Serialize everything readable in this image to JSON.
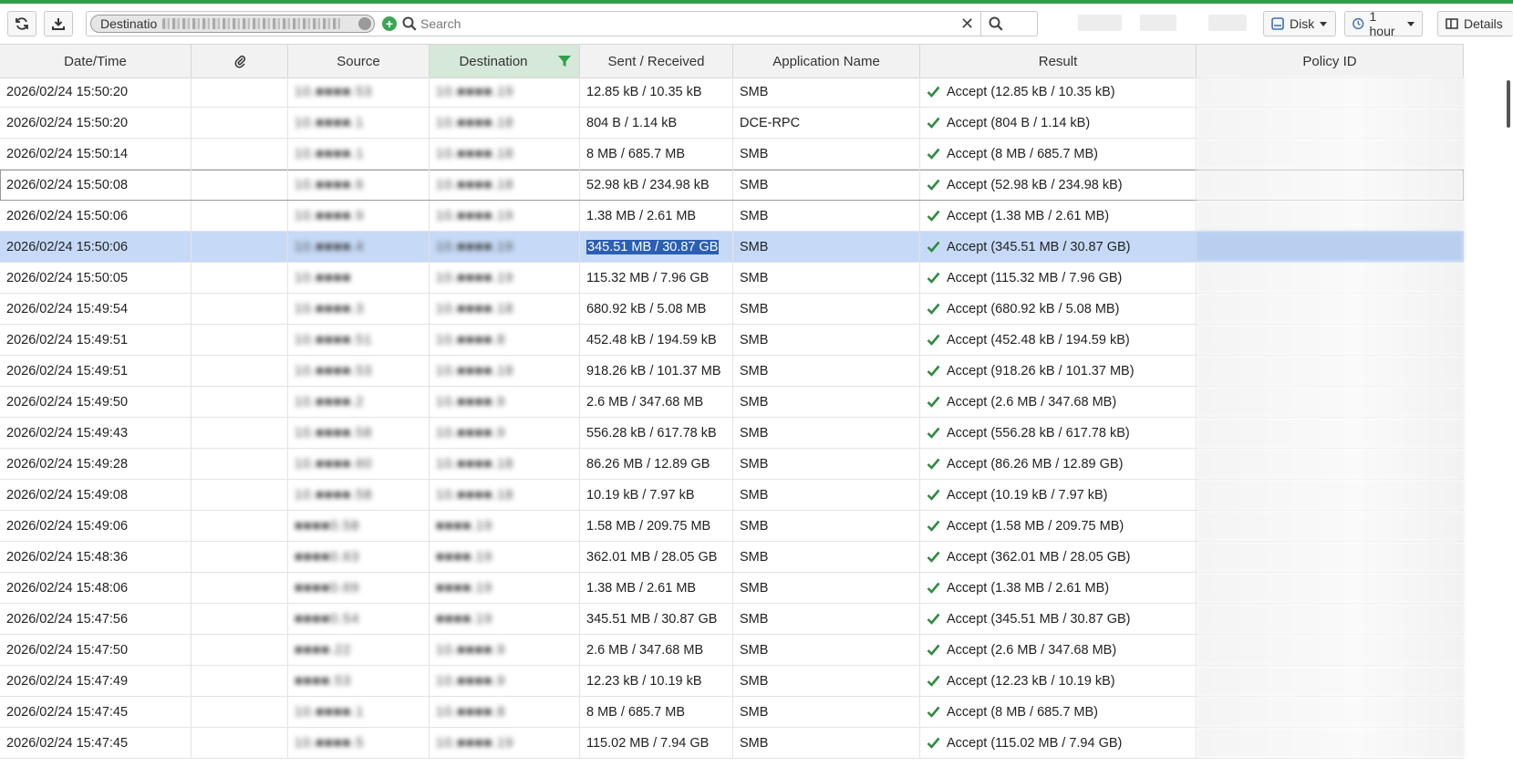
{
  "toolbar": {
    "refresh_icon": "refresh-icon",
    "download_icon": "download-icon",
    "filter_chip_label": "Destinatio",
    "search_placeholder": "Search",
    "clear_glyph": "✕",
    "storage_label": "Disk",
    "time_range_label": "1 hour",
    "details_label": "Details"
  },
  "columns": {
    "datetime": "Date/Time",
    "attachment_icon": "paperclip-icon",
    "source": "Source",
    "destination": "Destination",
    "sent_received": "Sent / Received",
    "app_name": "Application Name",
    "result": "Result",
    "policy_id": "Policy ID"
  },
  "rows": [
    {
      "datetime": "2026/02/24 15:50:20",
      "source": "10.■■■■.53",
      "destination": "10.■■■■.19",
      "sent_received": "12.85 kB / 10.35 kB",
      "app": "SMB",
      "result": "Accept (12.85 kB / 10.35 kB)"
    },
    {
      "datetime": "2026/02/24 15:50:20",
      "source": "10.■■■■.1",
      "destination": "10.■■■■.18",
      "sent_received": "804 B / 1.14 kB",
      "app": "DCE-RPC",
      "result": "Accept (804 B / 1.14 kB)"
    },
    {
      "datetime": "2026/02/24 15:50:14",
      "source": "10.■■■■.1",
      "destination": "10.■■■■.18",
      "sent_received": "8 MB / 685.7 MB",
      "app": "SMB",
      "result": "Accept (8 MB / 685.7 MB)"
    },
    {
      "datetime": "2026/02/24 15:50:08",
      "source": "10.■■■■.6",
      "destination": "10.■■■■.18",
      "sent_received": "52.98 kB / 234.98 kB",
      "app": "SMB",
      "result": "Accept (52.98 kB / 234.98 kB)"
    },
    {
      "datetime": "2026/02/24 15:50:06",
      "source": "10.■■■■.9",
      "destination": "10.■■■■.19",
      "sent_received": "1.38 MB / 2.61 MB",
      "app": "SMB",
      "result": "Accept (1.38 MB / 2.61 MB)"
    },
    {
      "datetime": "2026/02/24 15:50:06",
      "source": "10.■■■■.4",
      "destination": "10.■■■■.19",
      "sent_received": "345.51 MB / 30.87 GB",
      "app": "SMB",
      "result": "Accept (345.51 MB / 30.87 GB)"
    },
    {
      "datetime": "2026/02/24 15:50:05",
      "source": "10.■■■■",
      "destination": "10.■■■■.19",
      "sent_received": "115.32 MB / 7.96 GB",
      "app": "SMB",
      "result": "Accept (115.32 MB / 7.96 GB)"
    },
    {
      "datetime": "2026/02/24 15:49:54",
      "source": "10.■■■■.3",
      "destination": "10.■■■■.18",
      "sent_received": "680.92 kB / 5.08 MB",
      "app": "SMB",
      "result": "Accept (680.92 kB / 5.08 MB)"
    },
    {
      "datetime": "2026/02/24 15:49:51",
      "source": "10.■■■■.51",
      "destination": "10.■■■■.8",
      "sent_received": "452.48 kB / 194.59 kB",
      "app": "SMB",
      "result": "Accept (452.48 kB / 194.59 kB)"
    },
    {
      "datetime": "2026/02/24 15:49:51",
      "source": "10.■■■■.53",
      "destination": "10.■■■■.18",
      "sent_received": "918.26 kB / 101.37 MB",
      "app": "SMB",
      "result": "Accept (918.26 kB / 101.37 MB)"
    },
    {
      "datetime": "2026/02/24 15:49:50",
      "source": "10.■■■■.2",
      "destination": "10.■■■■.9",
      "sent_received": "2.6 MB / 347.68 MB",
      "app": "SMB",
      "result": "Accept (2.6 MB / 347.68 MB)"
    },
    {
      "datetime": "2026/02/24 15:49:43",
      "source": "10.■■■■.58",
      "destination": "10.■■■■.9",
      "sent_received": "556.28 kB / 617.78 kB",
      "app": "SMB",
      "result": "Accept (556.28 kB / 617.78 kB)"
    },
    {
      "datetime": "2026/02/24 15:49:28",
      "source": "10.■■■■.60",
      "destination": "10.■■■■.18",
      "sent_received": "86.26 MB / 12.89 GB",
      "app": "SMB",
      "result": "Accept (86.26 MB / 12.89 GB)"
    },
    {
      "datetime": "2026/02/24 15:49:08",
      "source": "10.■■■■.58",
      "destination": "10.■■■■.18",
      "sent_received": "10.19 kB / 7.97 kB",
      "app": "SMB",
      "result": "Accept (10.19 kB / 7.97 kB)"
    },
    {
      "datetime": "2026/02/24 15:49:06",
      "source": "■■■■0.58",
      "destination": "■■■■.19",
      "sent_received": "1.58 MB / 209.75 MB",
      "app": "SMB",
      "result": "Accept (1.58 MB / 209.75 MB)"
    },
    {
      "datetime": "2026/02/24 15:48:36",
      "source": "■■■■0.63",
      "destination": "■■■■.19",
      "sent_received": "362.01 MB / 28.05 GB",
      "app": "SMB",
      "result": "Accept (362.01 MB / 28.05 GB)"
    },
    {
      "datetime": "2026/02/24 15:48:06",
      "source": "■■■■0.69",
      "destination": "■■■■.19",
      "sent_received": "1.38 MB / 2.61 MB",
      "app": "SMB",
      "result": "Accept (1.38 MB / 2.61 MB)"
    },
    {
      "datetime": "2026/02/24 15:47:56",
      "source": "■■■■0.54",
      "destination": "■■■■.19",
      "sent_received": "345.51 MB / 30.87 GB",
      "app": "SMB",
      "result": "Accept (345.51 MB / 30.87 GB)"
    },
    {
      "datetime": "2026/02/24 15:47:50",
      "source": "■■■■.22",
      "destination": "10.■■■■.9",
      "sent_received": "2.6 MB / 347.68 MB",
      "app": "SMB",
      "result": "Accept (2.6 MB / 347.68 MB)"
    },
    {
      "datetime": "2026/02/24 15:47:49",
      "source": "■■■■.53",
      "destination": "10.■■■■.9",
      "sent_received": "12.23 kB / 10.19 kB",
      "app": "SMB",
      "result": "Accept (12.23 kB / 10.19 kB)"
    },
    {
      "datetime": "2026/02/24 15:47:45",
      "source": "10.■■■■.1",
      "destination": "10.■■■■.8",
      "sent_received": "8 MB / 685.7 MB",
      "app": "SMB",
      "result": "Accept (8 MB / 685.7 MB)"
    },
    {
      "datetime": "2026/02/24 15:47:45",
      "source": "10.■■■■.5",
      "destination": "10.■■■■.19",
      "sent_received": "115.02 MB / 7.94 GB",
      "app": "SMB",
      "result": "Accept (115.02 MB / 7.94 GB)"
    }
  ],
  "selected_row": 5,
  "focused_row": 3,
  "colors": {
    "accent_green": "#2e9e4a",
    "check_green": "#2e8b3e",
    "selection": "#c6daf7",
    "text_highlight": "#2b5fb3"
  }
}
